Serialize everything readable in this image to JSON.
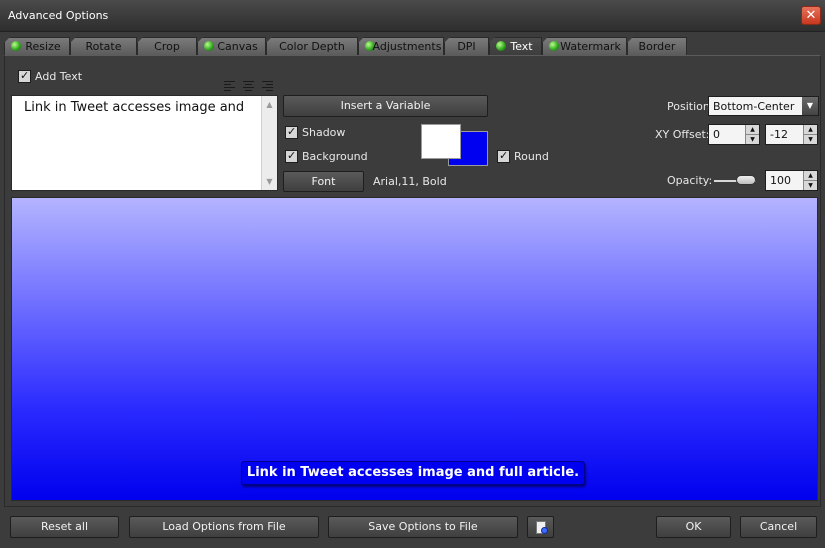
{
  "window": {
    "title": "Advanced Options"
  },
  "tabs": [
    {
      "label": "Resize",
      "has_dot": true
    },
    {
      "label": "Rotate",
      "has_dot": false
    },
    {
      "label": "Crop",
      "has_dot": false
    },
    {
      "label": "Canvas",
      "has_dot": true
    },
    {
      "label": "Color Depth",
      "has_dot": false
    },
    {
      "label": "Adjustments",
      "has_dot": true
    },
    {
      "label": "DPI",
      "has_dot": false
    },
    {
      "label": "Text",
      "has_dot": true,
      "active": true
    },
    {
      "label": "Watermark",
      "has_dot": true
    },
    {
      "label": "Border",
      "has_dot": false
    }
  ],
  "text_tab": {
    "add_text_label": "Add Text",
    "add_text_checked": true,
    "text_value": "Link in Tweet accesses image and",
    "insert_variable_label": "Insert a Variable",
    "shadow_label": "Shadow",
    "shadow_checked": true,
    "background_label": "Background",
    "background_checked": true,
    "round_label": "Round",
    "round_checked": true,
    "font_button_label": "Font",
    "font_description": "Arial,11, Bold",
    "text_color": "#ffffff",
    "background_color": "#0000f0",
    "position_label": "Position:",
    "position_value": "Bottom-Center",
    "xy_offset_label": "XY Offset:",
    "x_offset": "0",
    "y_offset": "-12",
    "opacity_label": "Opacity:",
    "opacity_value": "100",
    "opacity_fraction": 1.0
  },
  "preview": {
    "overlay_text": "Link in Tweet accesses image and full article."
  },
  "footer": {
    "reset_label": "Reset all",
    "load_label": "Load Options from File",
    "save_label": "Save Options to File",
    "ok_label": "OK",
    "cancel_label": "Cancel"
  }
}
